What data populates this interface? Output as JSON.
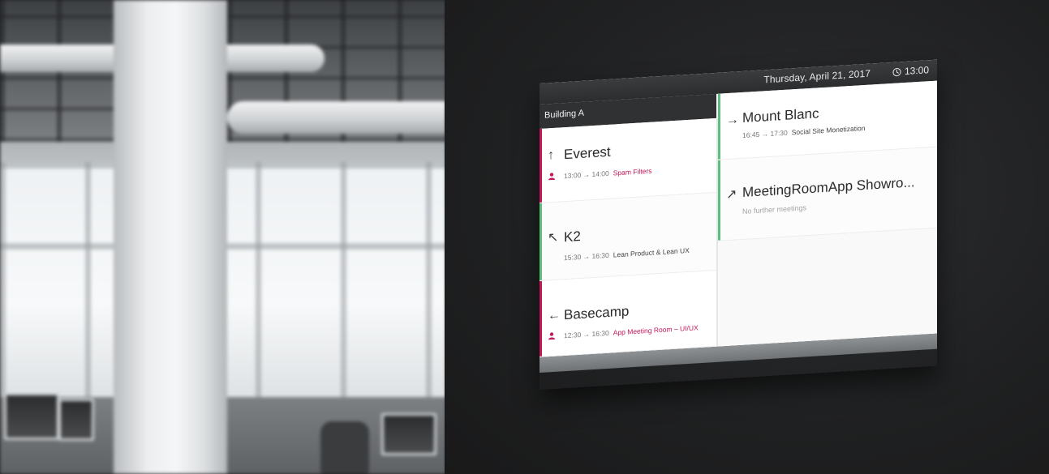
{
  "display": {
    "date": "Thursday, April 21, 2017",
    "time": "13:00",
    "building": "Building A"
  },
  "colors": {
    "busy": "#c2185b",
    "free": "#5cbf7e"
  },
  "rooms": [
    {
      "name": "Everest",
      "direction": "↑",
      "status": "busy",
      "time": "13:00 → 14:00",
      "title": "Spam Filters",
      "icon": "person-icon"
    },
    {
      "name": "K2",
      "direction": "↖",
      "status": "free",
      "time": "15:30 → 16:30",
      "title": "Lean Product & Lean UX"
    },
    {
      "name": "Basecamp",
      "direction": "←",
      "status": "busy",
      "time": "12:30 → 16:30",
      "title": "App Meeting Room – UI/UX",
      "icon": "person-icon"
    },
    {
      "name": "Mount Blanc",
      "direction": "→",
      "status": "free",
      "time": "16:45 → 17:30",
      "title": "Social Site Monetization"
    },
    {
      "name": "MeetingRoomApp Showro...",
      "direction": "↗",
      "status": "free",
      "no_meetings": "No further meetings"
    }
  ]
}
